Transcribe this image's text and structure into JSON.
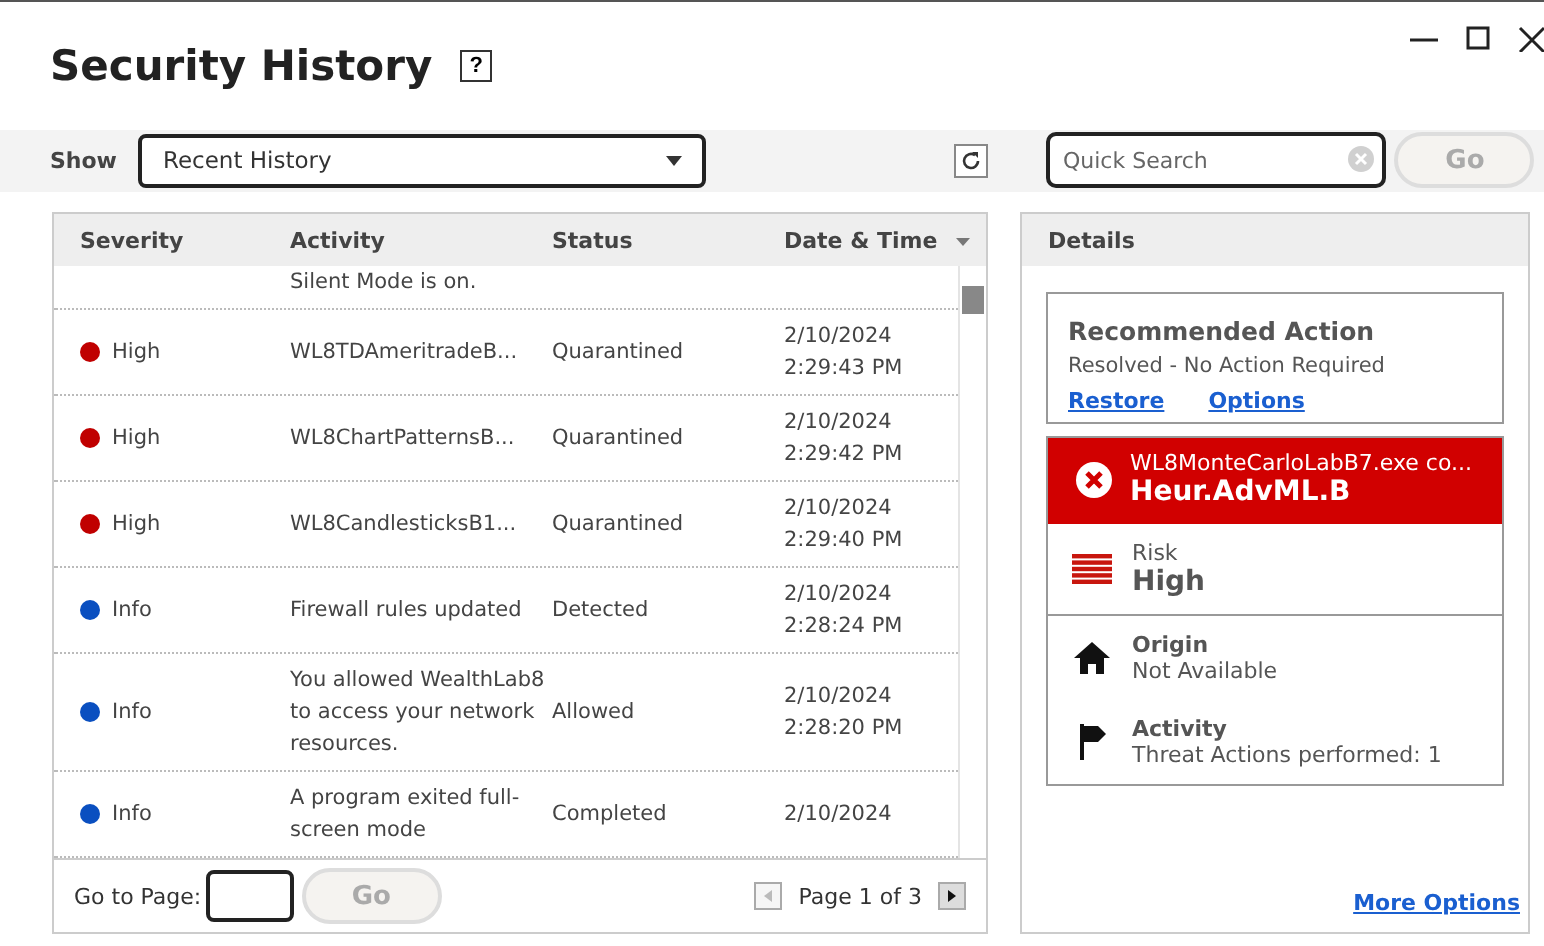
{
  "window": {
    "title": "Security History",
    "help": "?"
  },
  "toolbar": {
    "show_label": "Show",
    "filter": "Recent History",
    "search": {
      "placeholder": "Quick Search"
    },
    "go": "Go"
  },
  "table": {
    "columns": [
      "Severity",
      "Activity",
      "Status",
      "Date & Time"
    ],
    "rows": [
      {
        "severity": "",
        "activity": "Silent Mode is on.",
        "status": "",
        "date": "",
        "time": ""
      },
      {
        "severity": "High",
        "color": "#c00000",
        "activity": "WL8TDAmeritradeB...",
        "status": "Quarantined",
        "date": "2/10/2024",
        "time": "2:29:43 PM"
      },
      {
        "severity": "High",
        "color": "#c00000",
        "activity": "WL8ChartPatternsB...",
        "status": "Quarantined",
        "date": "2/10/2024",
        "time": "2:29:42 PM"
      },
      {
        "severity": "High",
        "color": "#c00000",
        "activity": "WL8CandlesticksB1...",
        "status": "Quarantined",
        "date": "2/10/2024",
        "time": "2:29:40 PM"
      },
      {
        "severity": "Info",
        "color": "#0a4fc0",
        "activity": "Firewall rules updated",
        "status": "Detected",
        "date": "2/10/2024",
        "time": "2:28:24 PM"
      },
      {
        "severity": "Info",
        "color": "#0a4fc0",
        "activity": "You allowed WealthLab8 to access your network resources.",
        "status": "Allowed",
        "date": "2/10/2024",
        "time": "2:28:20 PM"
      },
      {
        "severity": "Info",
        "color": "#0a4fc0",
        "activity": "A program exited full-screen mode",
        "status": "Completed",
        "date": "2/10/2024",
        "time": ""
      }
    ]
  },
  "pager": {
    "label": "Go to Page:",
    "go": "Go",
    "page": "Page 1 of 3"
  },
  "details": {
    "title": "Details",
    "recommended": {
      "title": "Recommended Action",
      "text": "Resolved - No Action Required",
      "links": [
        "Restore",
        "Options"
      ]
    },
    "threat": {
      "file": "WL8MonteCarloLabB7.exe co...",
      "name": "Heur.AdvML.B"
    },
    "risk": {
      "label": "Risk",
      "value": "High"
    },
    "info": [
      {
        "kind": "origin",
        "label": "Origin",
        "value": "Not Available"
      },
      {
        "kind": "activity",
        "label": "Activity",
        "value": "Threat Actions performed: 1"
      }
    ],
    "more": "More Options"
  }
}
